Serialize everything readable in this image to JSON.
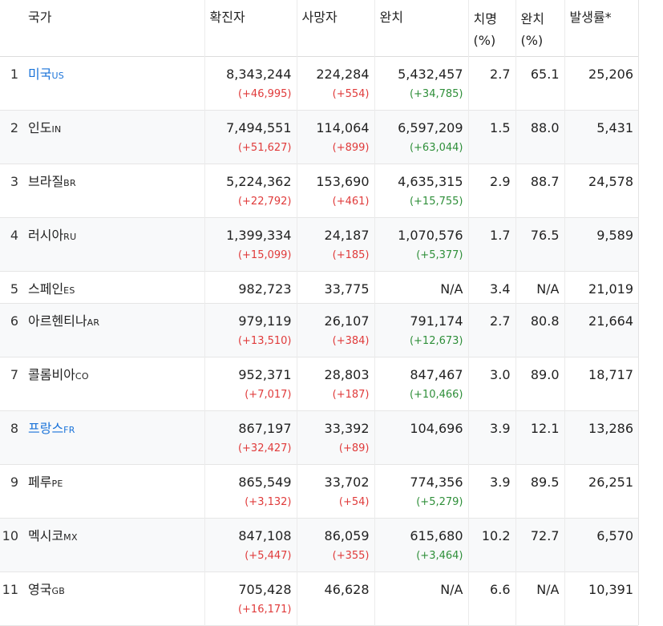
{
  "headers": {
    "country": "국가",
    "confirmed": "확진자",
    "deaths": "사망자",
    "recovered": "완치",
    "fatality_line1": "치명",
    "fatality_line2": "(%)",
    "recovery_line1": "완치",
    "recovery_line2": "(%)",
    "incidence": "발생률*"
  },
  "rows": [
    {
      "rank": "1",
      "name": "미국",
      "code": "US",
      "link": true,
      "confirmed": "8,343,244",
      "confirmed_chg": "(+46,995)",
      "deaths": "224,284",
      "deaths_chg": "(+554)",
      "recovered": "5,432,457",
      "recovered_chg": "(+34,785)",
      "fatality": "2.7",
      "recovery": "65.1",
      "incidence": "25,206"
    },
    {
      "rank": "2",
      "name": "인도",
      "code": "IN",
      "link": false,
      "confirmed": "7,494,551",
      "confirmed_chg": "(+51,627)",
      "deaths": "114,064",
      "deaths_chg": "(+899)",
      "recovered": "6,597,209",
      "recovered_chg": "(+63,044)",
      "fatality": "1.5",
      "recovery": "88.0",
      "incidence": "5,431"
    },
    {
      "rank": "3",
      "name": "브라질",
      "code": "BR",
      "link": false,
      "confirmed": "5,224,362",
      "confirmed_chg": "(+22,792)",
      "deaths": "153,690",
      "deaths_chg": "(+461)",
      "recovered": "4,635,315",
      "recovered_chg": "(+15,755)",
      "fatality": "2.9",
      "recovery": "88.7",
      "incidence": "24,578"
    },
    {
      "rank": "4",
      "name": "러시아",
      "code": "RU",
      "link": false,
      "confirmed": "1,399,334",
      "confirmed_chg": "(+15,099)",
      "deaths": "24,187",
      "deaths_chg": "(+185)",
      "recovered": "1,070,576",
      "recovered_chg": "(+5,377)",
      "fatality": "1.7",
      "recovery": "76.5",
      "incidence": "9,589"
    },
    {
      "rank": "5",
      "name": "스페인",
      "code": "ES",
      "link": false,
      "confirmed": "982,723",
      "confirmed_chg": "",
      "deaths": "33,775",
      "deaths_chg": "",
      "recovered": "N/A",
      "recovered_chg": "",
      "fatality": "3.4",
      "recovery": "N/A",
      "incidence": "21,019"
    },
    {
      "rank": "6",
      "name": "아르헨티나",
      "code": "AR",
      "link": false,
      "confirmed": "979,119",
      "confirmed_chg": "(+13,510)",
      "deaths": "26,107",
      "deaths_chg": "(+384)",
      "recovered": "791,174",
      "recovered_chg": "(+12,673)",
      "fatality": "2.7",
      "recovery": "80.8",
      "incidence": "21,664"
    },
    {
      "rank": "7",
      "name": "콜롬비아",
      "code": "CO",
      "link": false,
      "confirmed": "952,371",
      "confirmed_chg": "(+7,017)",
      "deaths": "28,803",
      "deaths_chg": "(+187)",
      "recovered": "847,467",
      "recovered_chg": "(+10,466)",
      "fatality": "3.0",
      "recovery": "89.0",
      "incidence": "18,717"
    },
    {
      "rank": "8",
      "name": "프랑스",
      "code": "FR",
      "link": true,
      "confirmed": "867,197",
      "confirmed_chg": "(+32,427)",
      "deaths": "33,392",
      "deaths_chg": "(+89)",
      "recovered": "104,696",
      "recovered_chg": "",
      "fatality": "3.9",
      "recovery": "12.1",
      "incidence": "13,286"
    },
    {
      "rank": "9",
      "name": "페루",
      "code": "PE",
      "link": false,
      "confirmed": "865,549",
      "confirmed_chg": "(+3,132)",
      "deaths": "33,702",
      "deaths_chg": "(+54)",
      "recovered": "774,356",
      "recovered_chg": "(+5,279)",
      "fatality": "3.9",
      "recovery": "89.5",
      "incidence": "26,251"
    },
    {
      "rank": "10",
      "name": "멕시코",
      "code": "MX",
      "link": false,
      "confirmed": "847,108",
      "confirmed_chg": "(+5,447)",
      "deaths": "86,059",
      "deaths_chg": "(+355)",
      "recovered": "615,680",
      "recovered_chg": "(+3,464)",
      "fatality": "10.2",
      "recovery": "72.7",
      "incidence": "6,570"
    },
    {
      "rank": "11",
      "name": "영국",
      "code": "GB",
      "link": false,
      "confirmed": "705,428",
      "confirmed_chg": "(+16,171)",
      "deaths": "46,628",
      "deaths_chg": "",
      "recovered": "N/A",
      "recovered_chg": "",
      "fatality": "6.6",
      "recovery": "N/A",
      "incidence": "10,391"
    }
  ],
  "colors": {
    "link": "#1a73d9",
    "increase_red": "#e03b3b",
    "increase_green": "#2f8f3a",
    "stripe": "#f8f9fa"
  }
}
